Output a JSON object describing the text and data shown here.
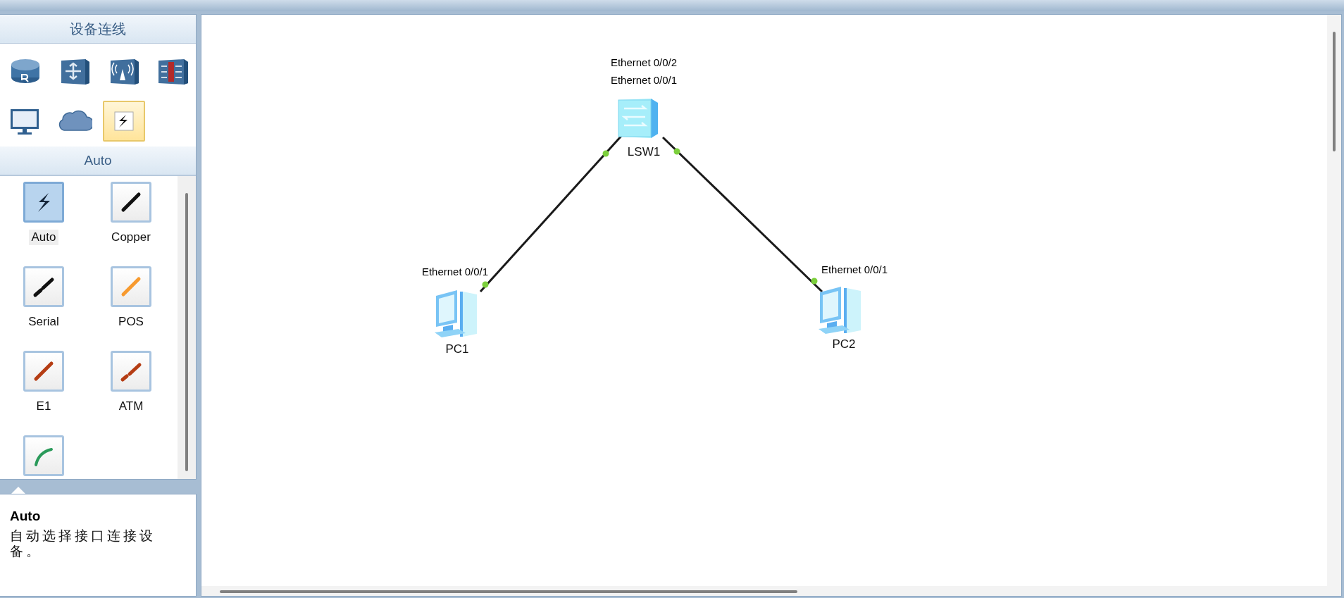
{
  "device_panel": {
    "title": "设备连线",
    "device_types": [
      {
        "kind": "router",
        "selected": false
      },
      {
        "kind": "switch",
        "selected": false
      },
      {
        "kind": "wireless",
        "selected": false
      },
      {
        "kind": "firewall",
        "selected": false
      },
      {
        "kind": "terminal",
        "selected": false
      },
      {
        "kind": "cloud",
        "selected": false
      },
      {
        "kind": "cable",
        "selected": true
      }
    ]
  },
  "cable_panel": {
    "title": "Auto",
    "cables": [
      {
        "kind": "auto",
        "label": "Auto",
        "selected": true
      },
      {
        "kind": "copper",
        "label": "Copper",
        "selected": false
      },
      {
        "kind": "serial",
        "label": "Serial",
        "selected": false
      },
      {
        "kind": "pos",
        "label": "POS",
        "selected": false
      },
      {
        "kind": "e1",
        "label": "E1",
        "selected": false
      },
      {
        "kind": "atm",
        "label": "ATM",
        "selected": false
      },
      {
        "kind": "ctl",
        "selected": false
      }
    ]
  },
  "tooltip": {
    "title": "Auto",
    "text": "自动选择接口连接设备。"
  },
  "topology": {
    "nodes": [
      {
        "kind": "switch",
        "name": "LSW1",
        "ports": [
          "Ethernet 0/0/2",
          "Ethernet 0/0/1"
        ]
      },
      {
        "kind": "pc",
        "name": "PC1",
        "ports": [
          "Ethernet 0/0/1"
        ]
      },
      {
        "kind": "pc",
        "name": "PC2",
        "ports": [
          "Ethernet 0/0/1"
        ]
      }
    ],
    "links": [
      {
        "kind": "copper",
        "up": true
      },
      {
        "kind": "copper",
        "up": true
      }
    ]
  }
}
